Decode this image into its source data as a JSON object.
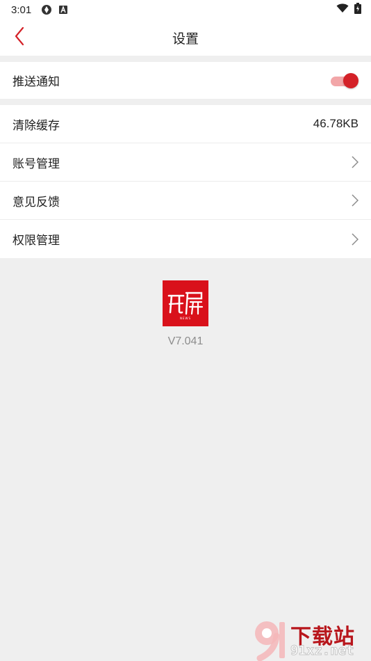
{
  "status_bar": {
    "time": "3:01",
    "left_icons": [
      "sync-icon",
      "a-badge-icon"
    ],
    "right_icons": [
      "wifi-icon",
      "battery-icon"
    ]
  },
  "header": {
    "back_icon": "chevron-left-icon",
    "title": "设置"
  },
  "settings": {
    "push": {
      "label": "推送通知",
      "enabled": true
    },
    "cache": {
      "label": "清除缓存",
      "value": "46.78KB"
    },
    "account": {
      "label": "账号管理"
    },
    "feedback": {
      "label": "意见反馈"
    },
    "permissions": {
      "label": "权限管理"
    }
  },
  "app": {
    "logo_text": "开屏",
    "logo_sub": "NEWS",
    "version": "V7.041"
  },
  "watermark": {
    "mark": "9",
    "title": "下载站",
    "site": "91xz.net"
  },
  "colors": {
    "accent": "#d42128",
    "logo_bg": "#d9111b",
    "toggle_track": "#f2a6a8",
    "page_bg": "#efefef"
  }
}
